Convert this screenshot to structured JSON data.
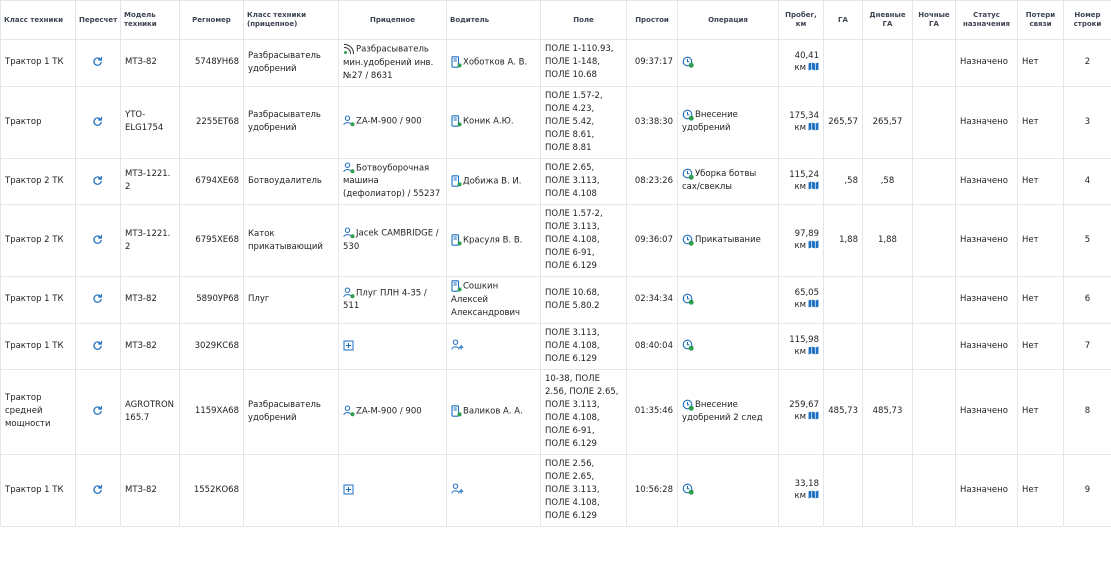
{
  "colors": {
    "accent": "#1b6ec2",
    "ok": "#2e9e4f",
    "border": "#e3e6ea"
  },
  "headers": {
    "class": "Класс техники",
    "recalc": "Пересчет",
    "model": "Модель техники",
    "regnum": "Регномер",
    "trailer_class": "Класс техники (прицепное)",
    "trailer": "Прицепное",
    "driver": "Водитель",
    "field": "Поле",
    "idle": "Простои",
    "operation": "Операция",
    "mileage": "Пробег, км",
    "ga": "ГА",
    "day_ga": "Дневные ГА",
    "night_ga": "Ночные ГА",
    "status": "Статус назначения",
    "loss": "Потери связи",
    "rownum": "Номер строки"
  },
  "rows": [
    {
      "class": "Трактор 1 ТК",
      "model": "МТЗ-82",
      "regnum": "5748УН68",
      "trailer_class": "Разбрасыватель удобрений",
      "trailer_icon": "signal-trailer-icon",
      "trailer": "Разбрасыватель мин.удобрений инв. №27 / 8631",
      "driver_icon": "driver-badge-icon",
      "driver": "Хоботков А. В.",
      "field": [
        "ПОЛЕ 1-110.93,",
        "ПОЛЕ 1-148,",
        "ПОЛЕ 10.68"
      ],
      "idle": "09:37:17",
      "operation": "",
      "mileage": "40,41",
      "km": "км",
      "ga": "",
      "day_ga": "",
      "night_ga": "",
      "status": "Назначено",
      "loss": "Нет",
      "rownum": "2"
    },
    {
      "class": "Трактор",
      "model": "YTO-ELG1754",
      "regnum": "2255ЕТ68",
      "trailer_class": "Разбрасыватель удобрений",
      "trailer_icon": "user-link-icon",
      "trailer": "ZA-M-900 / 900",
      "driver_icon": "driver-badge-icon",
      "driver": "Коник А.Ю.",
      "field": [
        "ПОЛЕ 1.57-2,",
        "ПОЛЕ 4.23,",
        "ПОЛЕ 5.42,",
        "ПОЛЕ 8.61,",
        "ПОЛЕ 8.81"
      ],
      "idle": "03:38:30",
      "operation": "Внесение удобрений",
      "mileage": "175,34",
      "km": "км",
      "ga": "265,57",
      "day_ga": "265,57",
      "night_ga": "",
      "status": "Назначено",
      "loss": "Нет",
      "rownum": "3"
    },
    {
      "class": "Трактор 2 ТК",
      "model": "МТЗ-1221.2",
      "regnum": "6794ХЕ68",
      "trailer_class": "Ботвоудалитель",
      "trailer_icon": "user-link-icon",
      "trailer": "Ботвоуборочная машина (дефолиатор) / 55237",
      "driver_icon": "driver-badge-icon",
      "driver": "Добижа В. И.",
      "field": [
        "ПОЛЕ 2.65,",
        "ПОЛЕ 3.113,",
        "ПОЛЕ 4.108"
      ],
      "idle": "08:23:26",
      "operation": "Уборка ботвы сах/свеклы",
      "mileage": "115,24",
      "km": "км",
      "ga": ",58",
      "day_ga": ",58",
      "night_ga": "",
      "status": "Назначено",
      "loss": "Нет",
      "rownum": "4"
    },
    {
      "class": "Трактор 2 ТК",
      "model": "МТЗ-1221.2",
      "regnum": "6795ХЕ68",
      "trailer_class": "Каток прикатывающий",
      "trailer_icon": "user-link-icon",
      "trailer": "Jacek CAMBRIDGE / 530",
      "driver_icon": "driver-badge-icon",
      "driver": "Красуля В. В.",
      "field": [
        "ПОЛЕ 1.57-2,",
        "ПОЛЕ 3.113,",
        "ПОЛЕ 4.108,",
        "ПОЛЕ 6-91,",
        "ПОЛЕ 6.129"
      ],
      "idle": "09:36:07",
      "operation": "Прикатывание",
      "mileage": "97,89",
      "km": "км",
      "ga": "1,88",
      "day_ga": "1,88",
      "night_ga": "",
      "status": "Назначено",
      "loss": "Нет",
      "rownum": "5"
    },
    {
      "class": "Трактор 1 ТК",
      "model": "МТЗ-82",
      "regnum": "5890УР68",
      "trailer_class": "Плуг",
      "trailer_icon": "user-link-icon",
      "trailer": "Плуг ПЛН 4-35 / 511",
      "driver_icon": "driver-badge-icon",
      "driver": "Сошкин Алексей Александрович",
      "field": [
        "ПОЛЕ 10.68,",
        "ПОЛЕ 5.80.2"
      ],
      "idle": "02:34:34",
      "operation": "",
      "mileage": "65,05",
      "km": "км",
      "ga": "",
      "day_ga": "",
      "night_ga": "",
      "status": "Назначено",
      "loss": "Нет",
      "rownum": "6"
    },
    {
      "class": "Трактор 1 ТК",
      "model": "МТЗ-82",
      "regnum": "3029КС68",
      "trailer_class": "",
      "trailer_icon": "add-box-icon",
      "trailer": "",
      "driver_icon": "add-user-icon",
      "driver": "",
      "field": [
        "ПОЛЕ 3.113,",
        "ПОЛЕ 4.108,",
        "ПОЛЕ 6.129"
      ],
      "idle": "08:40:04",
      "operation": "",
      "mileage": "115,98",
      "km": "км",
      "ga": "",
      "day_ga": "",
      "night_ga": "",
      "status": "Назначено",
      "loss": "Нет",
      "rownum": "7"
    },
    {
      "class": "Трактор средней мощности",
      "model": "AGROTRON 165.7",
      "regnum": "1159ХА68",
      "trailer_class": "Разбрасыватель удобрений",
      "trailer_icon": "user-link-icon",
      "trailer": "ZA-M-900 / 900",
      "driver_icon": "driver-badge-icon",
      "driver": "Валиков А. А.",
      "field": [
        "10-38, ПОЛЕ",
        "2.56, ПОЛЕ 2.65,",
        "ПОЛЕ 3.113,",
        "ПОЛЕ 4.108,",
        "ПОЛЕ 6-91,",
        "ПОЛЕ 6.129"
      ],
      "idle": "01:35:46",
      "operation": "Внесение удобрений 2 след",
      "mileage": "259,67",
      "km": "км",
      "ga": "485,73",
      "day_ga": "485,73",
      "night_ga": "",
      "status": "Назначено",
      "loss": "Нет",
      "rownum": "8"
    },
    {
      "class": "Трактор 1 ТК",
      "model": "МТЗ-82",
      "regnum": "1552КО68",
      "trailer_class": "",
      "trailer_icon": "add-box-icon",
      "trailer": "",
      "driver_icon": "add-user-icon",
      "driver": "",
      "field": [
        "ПОЛЕ 2.56,",
        "ПОЛЕ 2.65,",
        "ПОЛЕ 3.113,",
        "ПОЛЕ 4.108,",
        "ПОЛЕ 6.129"
      ],
      "idle": "10:56:28",
      "operation": "",
      "mileage": "33,18",
      "km": "км",
      "ga": "",
      "day_ga": "",
      "night_ga": "",
      "status": "Назначено",
      "loss": "Нет",
      "rownum": "9"
    }
  ]
}
